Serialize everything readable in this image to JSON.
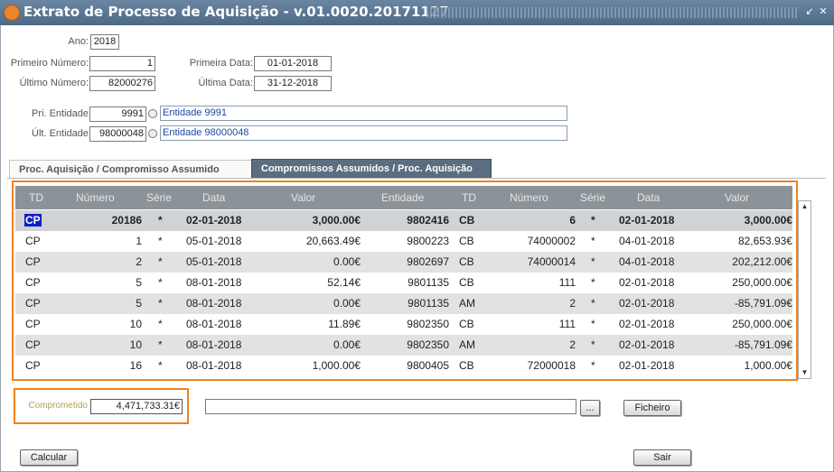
{
  "window": {
    "title": "Extrato de Processo de Aquisição - v.01.0020.20171127",
    "minimize_icon": "arrow-down-left-icon",
    "close_icon": "close-icon"
  },
  "form": {
    "ano_label": "Ano:",
    "ano_value": "2018",
    "primeiro_numero_label": "Primeiro Número:",
    "primeiro_numero_value": "1",
    "ultimo_numero_label": "Último Número:",
    "ultimo_numero_value": "82000276",
    "primeira_data_label": "Primeira Data:",
    "primeira_data_value": "01-01-2018",
    "ultima_data_label": "Última Data:",
    "ultima_data_value": "31-12-2018",
    "pri_entidade_label": "Pri. Entidade",
    "pri_entidade_value": "9991",
    "pri_entidade_name": "Entidade 9991",
    "ult_entidade_label": "Últ. Entidade",
    "ult_entidade_value": "98000048",
    "ult_entidade_name": "Entidade 98000048"
  },
  "tabs": [
    {
      "label": "Proc. Aquisição / Compromisso Assumido",
      "active": false
    },
    {
      "label": "Compromissos Assumidos / Proc. Aquisição",
      "active": true
    }
  ],
  "table": {
    "headers": [
      "TD",
      "Número",
      "Série",
      "Data",
      "Valor",
      "Entidade",
      "TD",
      "Número",
      "Série",
      "Data",
      "Valor"
    ],
    "rows": [
      [
        "CP",
        "20186",
        "*",
        "02-01-2018",
        "3,000.00€",
        "9802416",
        "CB",
        "6",
        "*",
        "02-01-2018",
        "3,000.00€"
      ],
      [
        "CP",
        "1",
        "*",
        "05-01-2018",
        "20,663.49€",
        "9800223",
        "CB",
        "74000002",
        "*",
        "04-01-2018",
        "82,653.93€"
      ],
      [
        "CP",
        "2",
        "*",
        "05-01-2018",
        "0.00€",
        "9802697",
        "CB",
        "74000014",
        "*",
        "04-01-2018",
        "202,212.00€"
      ],
      [
        "CP",
        "5",
        "*",
        "08-01-2018",
        "52.14€",
        "9801135",
        "CB",
        "111",
        "*",
        "02-01-2018",
        "250,000.00€"
      ],
      [
        "CP",
        "5",
        "*",
        "08-01-2018",
        "0.00€",
        "9801135",
        "AM",
        "2",
        "*",
        "02-01-2018",
        "-85,791.09€"
      ],
      [
        "CP",
        "10",
        "*",
        "08-01-2018",
        "11.89€",
        "9802350",
        "CB",
        "111",
        "*",
        "02-01-2018",
        "250,000.00€"
      ],
      [
        "CP",
        "10",
        "*",
        "08-01-2018",
        "0.00€",
        "9802350",
        "AM",
        "2",
        "*",
        "02-01-2018",
        "-85,791.09€"
      ],
      [
        "CP",
        "16",
        "*",
        "08-01-2018",
        "1,000.00€",
        "9800405",
        "CB",
        "72000018",
        "*",
        "02-01-2018",
        "1,000.00€"
      ]
    ]
  },
  "footer": {
    "comprometido_label": "Comprometido",
    "comprometido_value": "4,471,733.31€",
    "file_path_value": "",
    "browse_label": "...",
    "ficheiro_label": "Ficheiro",
    "calcular_label": "Calcular",
    "sair_label": "Sair"
  }
}
